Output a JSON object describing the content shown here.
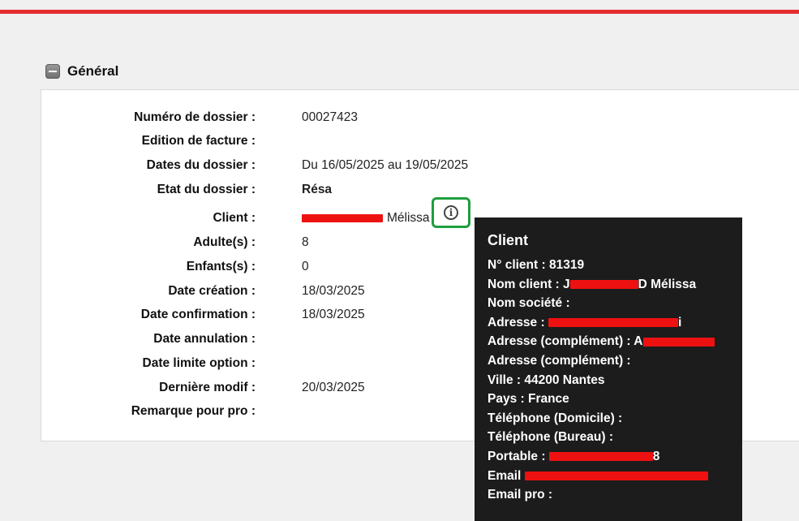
{
  "section": {
    "title": "Général"
  },
  "fields": [
    {
      "label": "Numéro de dossier :",
      "value": "00027423"
    },
    {
      "label": "Edition de facture :",
      "value": ""
    },
    {
      "label": "Dates du dossier :",
      "value": "Du 16/05/2025 au 19/05/2025"
    },
    {
      "label": "Etat du dossier :",
      "value": "Résa"
    },
    {
      "label": "Client :",
      "value": "Mélissa"
    },
    {
      "label": "Adulte(s) :",
      "value": "8"
    },
    {
      "label": "Enfants(s) :",
      "value": "0"
    },
    {
      "label": "Date création :",
      "value": "18/03/2025"
    },
    {
      "label": "Date confirmation :",
      "value": "18/03/2025"
    },
    {
      "label": "Date annulation :",
      "value": ""
    },
    {
      "label": "Date limite option :",
      "value": ""
    },
    {
      "label": "Dernière modif :",
      "value": "20/03/2025"
    },
    {
      "label": "Remarque pour pro :",
      "value": ""
    }
  ],
  "tooltip": {
    "title": "Client",
    "lines": {
      "client_no": "N° client : 81319",
      "nom_client_prefix": "Nom client : J",
      "nom_client_suffix": "D Mélissa",
      "nom_societe": "Nom société :",
      "adresse_prefix": "Adresse :",
      "adresse_suffix": "i",
      "adresse_comp1_prefix": "Adresse (complément) : A",
      "adresse_comp2": "Adresse (complément) :",
      "ville": "Ville : 44200 Nantes",
      "pays": "Pays : France",
      "tel_domicile": "Téléphone (Domicile) :",
      "tel_bureau": "Téléphone (Bureau) :",
      "portable_prefix": "Portable :",
      "portable_suffix": "8",
      "email_prefix": "Email",
      "email_pro": "Email pro :"
    }
  },
  "colors": {
    "accent_bar": "#e52d32",
    "highlight_border": "#1e9e3e",
    "tooltip_bg": "#1c1c1c",
    "redaction": "#ee1111"
  },
  "icons": {
    "collapse": "minus-square-icon",
    "info": "info-circle-icon"
  }
}
